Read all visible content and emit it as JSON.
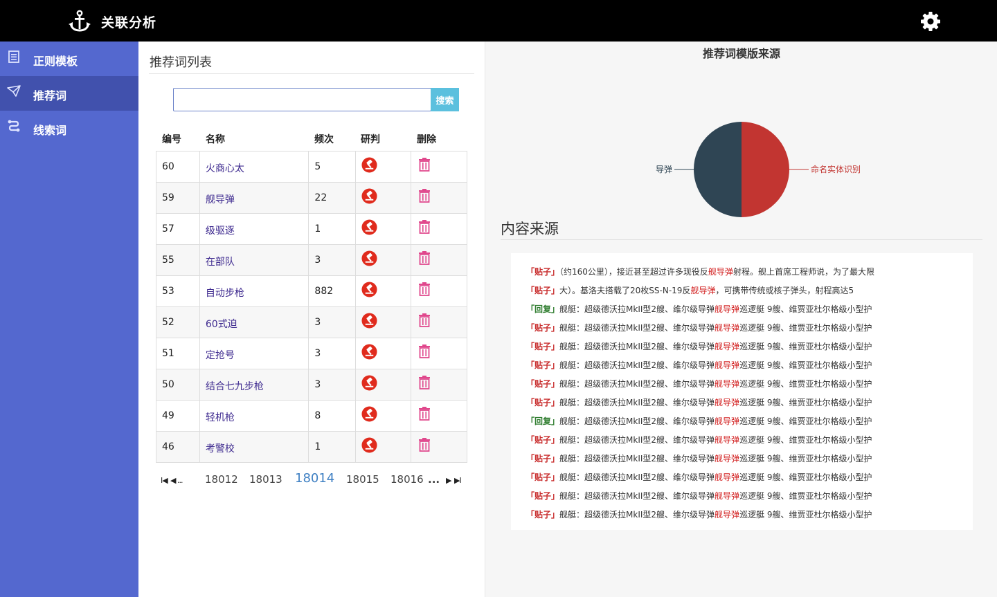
{
  "app": {
    "title": "关联分析",
    "logo_icon": "anchor-icon",
    "settings_icon": "gear-icon"
  },
  "sidebar": {
    "items": [
      {
        "label": "正则模板",
        "icon": "document-icon",
        "active": false
      },
      {
        "label": "推荐词",
        "icon": "paper-plane-icon",
        "active": true
      },
      {
        "label": "线索词",
        "icon": "link-chain-icon",
        "active": false
      }
    ]
  },
  "word_list": {
    "title": "推荐词列表",
    "search": {
      "value": "",
      "placeholder": "",
      "button_label": "搜索"
    },
    "columns": [
      "编号",
      "名称",
      "频次",
      "研判",
      "删除"
    ],
    "rows": [
      {
        "id": "60",
        "name": "火商心太",
        "freq": "5"
      },
      {
        "id": "59",
        "name": "舰导弹",
        "freq": "22"
      },
      {
        "id": "57",
        "name": "级驱逐",
        "freq": "1"
      },
      {
        "id": "55",
        "name": "在部队",
        "freq": "3"
      },
      {
        "id": "53",
        "name": "自动步枪",
        "freq": "882"
      },
      {
        "id": "52",
        "name": "60式迫",
        "freq": "3"
      },
      {
        "id": "51",
        "name": "定抢号",
        "freq": "3"
      },
      {
        "id": "50",
        "name": "结合七九步枪",
        "freq": "3"
      },
      {
        "id": "49",
        "name": "轻机枪",
        "freq": "8"
      },
      {
        "id": "46",
        "name": "考警校",
        "freq": "1"
      }
    ],
    "judge_icon": "gavel-icon",
    "delete_icon": "trash-icon",
    "pagination": {
      "first": "I◀",
      "prev": "◀ ...",
      "pages": [
        "18012",
        "18013",
        "18014",
        "18015",
        "18016"
      ],
      "current": "18014",
      "ellipsis": "...",
      "next": "▶",
      "last": "▶I"
    }
  },
  "template_source": {
    "title": "推荐词模版来源",
    "chart_data": {
      "type": "pie",
      "title": "推荐词模版来源",
      "slices": [
        {
          "label": "命名实体识别",
          "value": 50,
          "color": "#c23531"
        },
        {
          "label": "导弹",
          "value": 50,
          "color": "#2f4554"
        }
      ]
    }
  },
  "content_source": {
    "title": "内容来源",
    "lines": [
      {
        "tag": "「贴子」",
        "type": "post",
        "before": "（约160公里），接近甚至超过许多现役反",
        "highlight": "舰导弹",
        "after": "射程。舰上首席工程师说，为了最大限"
      },
      {
        "tag": "「贴子」",
        "type": "post",
        "before": "大）。基洛夫搭载了20枚SS-N-19反",
        "highlight": "舰导弹",
        "after": "，可携带传统或核子弹头，射程高达5"
      },
      {
        "tag": "「回复」",
        "type": "reply",
        "before": "舰艇：超级德沃拉MkII型2艘、维尔级导弹",
        "highlight": "舰导弹",
        "after": "巡逻艇 9艘、维贾亚杜尔格级小型护"
      },
      {
        "tag": "「贴子」",
        "type": "post",
        "before": "舰艇：超级德沃拉MkII型2艘、维尔级导弹",
        "highlight": "舰导弹",
        "after": "巡逻艇 9艘、维贾亚杜尔格级小型护"
      },
      {
        "tag": "「贴子」",
        "type": "post",
        "before": "舰艇：超级德沃拉MkII型2艘、维尔级导弹",
        "highlight": "舰导弹",
        "after": "巡逻艇 9艘、维贾亚杜尔格级小型护"
      },
      {
        "tag": "「贴子」",
        "type": "post",
        "before": "舰艇：超级德沃拉MkII型2艘、维尔级导弹",
        "highlight": "舰导弹",
        "after": "巡逻艇 9艘、维贾亚杜尔格级小型护"
      },
      {
        "tag": "「贴子」",
        "type": "post",
        "before": "舰艇：超级德沃拉MkII型2艘、维尔级导弹",
        "highlight": "舰导弹",
        "after": "巡逻艇 9艘、维贾亚杜尔格级小型护"
      },
      {
        "tag": "「贴子」",
        "type": "post",
        "before": "舰艇：超级德沃拉MkII型2艘、维尔级导弹",
        "highlight": "舰导弹",
        "after": "巡逻艇 9艘、维贾亚杜尔格级小型护"
      },
      {
        "tag": "「回复」",
        "type": "reply",
        "before": "舰艇：超级德沃拉MkII型2艘、维尔级导弹",
        "highlight": "舰导弹",
        "after": "巡逻艇 9艘、维贾亚杜尔格级小型护"
      },
      {
        "tag": "「贴子」",
        "type": "post",
        "before": "舰艇：超级德沃拉MkII型2艘、维尔级导弹",
        "highlight": "舰导弹",
        "after": "巡逻艇 9艘、维贾亚杜尔格级小型护"
      },
      {
        "tag": "「贴子」",
        "type": "post",
        "before": "舰艇：超级德沃拉MkII型2艘、维尔级导弹",
        "highlight": "舰导弹",
        "after": "巡逻艇 9艘、维贾亚杜尔格级小型护"
      },
      {
        "tag": "「贴子」",
        "type": "post",
        "before": "舰艇：超级德沃拉MkII型2艘、维尔级导弹",
        "highlight": "舰导弹",
        "after": "巡逻艇 9艘、维贾亚杜尔格级小型护"
      },
      {
        "tag": "「贴子」",
        "type": "post",
        "before": "舰艇：超级德沃拉MkII型2艘、维尔级导弹",
        "highlight": "舰导弹",
        "after": "巡逻艇 9艘、维贾亚杜尔格级小型护"
      },
      {
        "tag": "「贴子」",
        "type": "post",
        "before": "舰艇：超级德沃拉MkII型2艘、维尔级导弹",
        "highlight": "舰导弹",
        "after": "巡逻艇 9艘、维贾亚杜尔格级小型护"
      }
    ]
  },
  "colors": {
    "topbar": "#000000",
    "sidebar": "#5468cf",
    "sidebar_active": "#4151ad",
    "search_button": "#5bc0de",
    "link": "#3e2a8f",
    "judge_icon": "#e02b1d",
    "delete_icon": "#e0478c",
    "highlight": "#d21f1f",
    "post_tag": "#c82c2c",
    "reply_tag": "#2f7d2f"
  }
}
